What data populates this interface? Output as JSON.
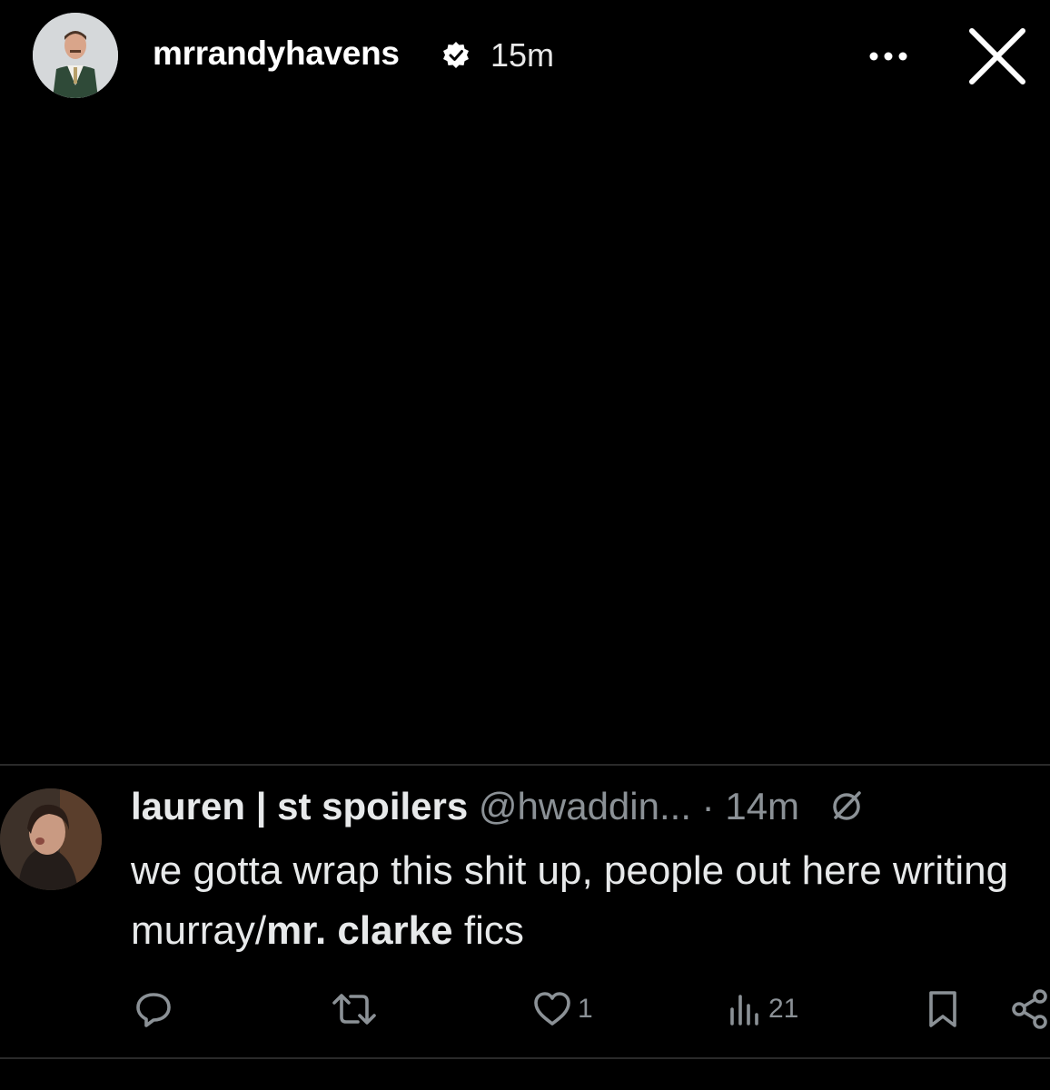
{
  "story": {
    "username": "mrrandyhavens",
    "verified": true,
    "time": "15m",
    "more_icon": "ellipsis-icon",
    "close_icon": "close-icon"
  },
  "tweet": {
    "author": "lauren | st spoilers",
    "handle": "@hwaddin...",
    "separator": "·",
    "time": "14m",
    "text_before": "we gotta wrap this shit up, people out here writing murray/",
    "text_bold": "mr. clarke",
    "text_after": " fics",
    "actions": {
      "reply_icon": "reply-icon",
      "retweet_icon": "retweet-icon",
      "like_count": "1",
      "views_count": "21",
      "bookmark_icon": "bookmark-icon",
      "share_icon": "share-icon"
    }
  },
  "colors": {
    "background": "#000000",
    "primary_text": "#e7e9ea",
    "secondary_text": "#8b9196",
    "divider": "#2a2a2a"
  }
}
